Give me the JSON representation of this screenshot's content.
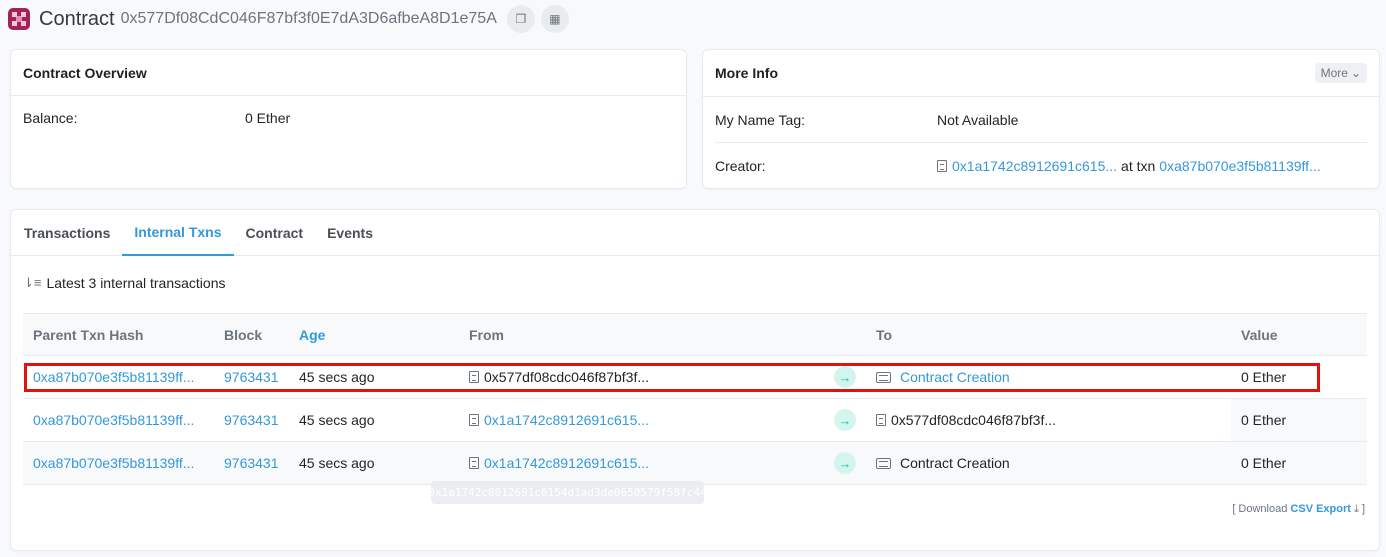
{
  "header": {
    "title": "Contract",
    "address": "0x577Df08CdC046F87bf3f0E7dA3D6afbeA8D1e75A"
  },
  "overview": {
    "title": "Contract Overview",
    "balance_label": "Balance:",
    "balance_value": "0 Ether"
  },
  "more_info": {
    "title": "More Info",
    "more_button": "More",
    "name_tag_label": "My Name Tag:",
    "name_tag_value": "Not Available",
    "creator_label": "Creator:",
    "creator_address": "0x1a1742c8912691c615...",
    "at_txn": "at txn",
    "creator_txn": "0xa87b070e3f5b81139ff..."
  },
  "tabs": [
    {
      "label": "Transactions"
    },
    {
      "label": "Internal Txns"
    },
    {
      "label": "Contract"
    },
    {
      "label": "Events"
    }
  ],
  "subheading": "Latest 3 internal transactions",
  "table": {
    "headers": [
      "Parent Txn Hash",
      "Block",
      "Age",
      "From",
      "",
      "To",
      "Value"
    ],
    "rows": [
      {
        "hash": "0xa87b070e3f5b81139ff...",
        "block": "9763431",
        "age": "45 secs ago",
        "from": "0x577df08cdc046f87bf3f...",
        "to": "Contract Creation",
        "value": "0 Ether"
      },
      {
        "hash": "0xa87b070e3f5b81139ff...",
        "block": "9763431",
        "age": "45 secs ago",
        "from": "0x1a1742c8912691c615...",
        "to": "0x577df08cdc046f87bf3f...",
        "value": "0 Ether"
      },
      {
        "hash": "0xa87b070e3f5b81139ff...",
        "block": "9763431",
        "age": "45 secs ago",
        "from": "0x1a1742c8912691c615...",
        "to": "Contract Creation",
        "value": "0 Ether"
      }
    ]
  },
  "tooltip": "0x1a1742c8912691c6154d1ad3de0650579f58fc44",
  "csv": {
    "prefix": "[ Download",
    "link": "CSV Export",
    "suffix": "]"
  }
}
